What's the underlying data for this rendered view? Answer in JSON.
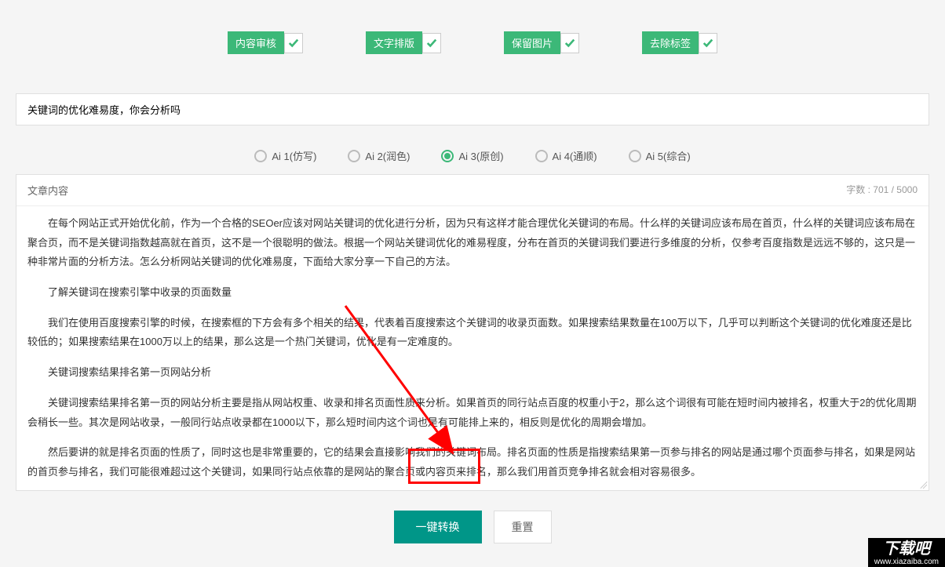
{
  "options": [
    {
      "label": "内容审核"
    },
    {
      "label": "文字排版"
    },
    {
      "label": "保留图片"
    },
    {
      "label": "去除标签"
    }
  ],
  "title_input": {
    "value": "关键词的优化难易度，你会分析吗"
  },
  "radio": {
    "items": [
      {
        "label": "Ai 1(仿写)"
      },
      {
        "label": "Ai 2(润色)"
      },
      {
        "label": "Ai 3(原创)"
      },
      {
        "label": "Ai 4(通顺)"
      },
      {
        "label": "Ai 5(综合)"
      }
    ],
    "selected": 2
  },
  "content": {
    "header_label": "文章内容",
    "char_count_label": "字数 : 701 / 5000",
    "paragraphs": [
      "在每个网站正式开始优化前，作为一个合格的SEOer应该对网站关键词的优化进行分析，因为只有这样才能合理优化关键词的布局。什么样的关键词应该布局在首页，什么样的关键词应该布局在聚合页，而不是关键词指数越高就在首页，这不是一个很聪明的做法。根据一个网站关键词优化的难易程度，分布在首页的关键词我们要进行多维度的分析，仅参考百度指数是远远不够的，这只是一种非常片面的分析方法。怎么分析网站关键词的优化难易度，下面给大家分享一下自己的方法。",
      "",
      "了解关键词在搜索引擎中收录的页面数量",
      "",
      "我们在使用百度搜索引擎的时候，在搜索框的下方会有多个相关的结果，代表着百度搜索这个关键词的收录页面数。如果搜索结果数量在100万以下，几乎可以判断这个关键词的优化难度还是比较低的；如果搜索结果在1000万以上的结果，那么这是一个热门关键词，优化是有一定难度的。",
      "",
      "关键词搜索结果排名第一页网站分析",
      "",
      "关键词搜索结果排名第一页的网站分析主要是指从网站权重、收录和排名页面性质来分析。如果首页的同行站点百度的权重小于2，那么这个词很有可能在短时间内被排名，权重大于2的优化周期会稍长一些。其次是网站收录，一般同行站点收录都在1000以下，那么短时间内这个词也是有可能排上来的，相反则是优化的周期会增加。",
      "",
      "然后要讲的就是排名页面的性质了，同时这也是非常重要的，它的结果会直接影响我们的关键词布局。排名页面的性质是指搜索结果第一页参与排名的网站是通过哪个页面参与排名，如果是网站的首页参与排名，我们可能很难超过这个关键词，如果同行站点依靠的是网站的聚合页或内容页来排名，那么我们用首页竞争排名就会相对容易很多。"
    ]
  },
  "buttons": {
    "primary": "一键转换",
    "secondary": "重置"
  },
  "watermark": {
    "main": "下载吧",
    "url": "www.xiazaiba.com"
  }
}
